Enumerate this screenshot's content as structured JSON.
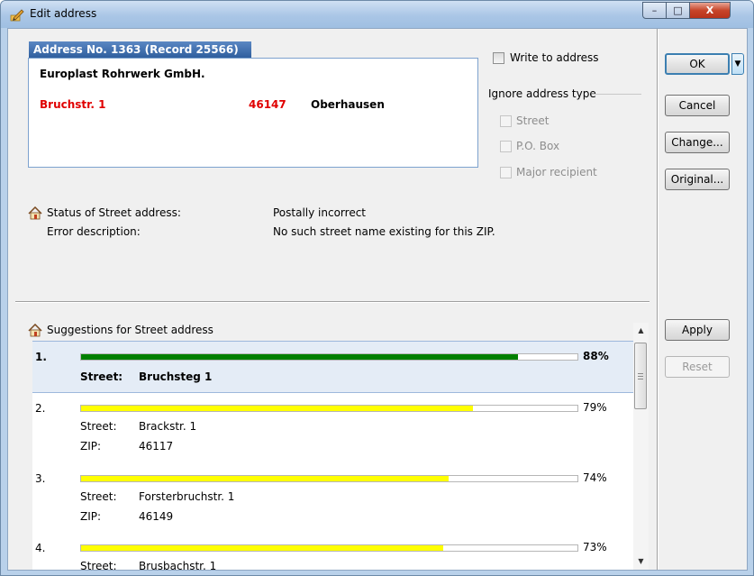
{
  "window": {
    "title": "Edit address",
    "controls": {
      "minimize": "–",
      "maximize": "□",
      "close": "X"
    }
  },
  "address": {
    "header": "Address No. 1363 (Record 25566)",
    "company": "Europlast Rohrwerk GmbH.",
    "street": "Bruchstr. 1",
    "zip": "46147",
    "city": "Oberhausen",
    "highlight_color": "#e00000"
  },
  "options": {
    "write_to_address": "Write to address",
    "ignore_group": "Ignore address type",
    "ignore_items": [
      "Street",
      "P.O. Box",
      "Major recipient"
    ]
  },
  "status": {
    "label": "Status of Street address:",
    "value": "Postally incorrect",
    "error_label": "Error description:",
    "error_value": "No such street name existing for this ZIP."
  },
  "buttons": {
    "ok": "OK",
    "ok_dropdown": "▼",
    "cancel": "Cancel",
    "change": "Change...",
    "original": "Original...",
    "apply": "Apply",
    "reset": "Reset"
  },
  "suggestions": {
    "title": "Suggestions for Street address",
    "street_label": "Street:",
    "zip_label": "ZIP:",
    "items": [
      {
        "num": "1.",
        "pct": "88%",
        "score": 0.88,
        "color": "#008000",
        "street": "Bruchsteg 1",
        "zip": ""
      },
      {
        "num": "2.",
        "pct": "79%",
        "score": 0.79,
        "color": "#ffff00",
        "street": "Brackstr. 1",
        "zip": "46117"
      },
      {
        "num": "3.",
        "pct": "74%",
        "score": 0.74,
        "color": "#ffff00",
        "street": "Forsterbruchstr. 1",
        "zip": "46149"
      },
      {
        "num": "4.",
        "pct": "73%",
        "score": 0.73,
        "color": "#ffff00",
        "street": "Brusbachstr. 1",
        "zip": ""
      }
    ]
  }
}
